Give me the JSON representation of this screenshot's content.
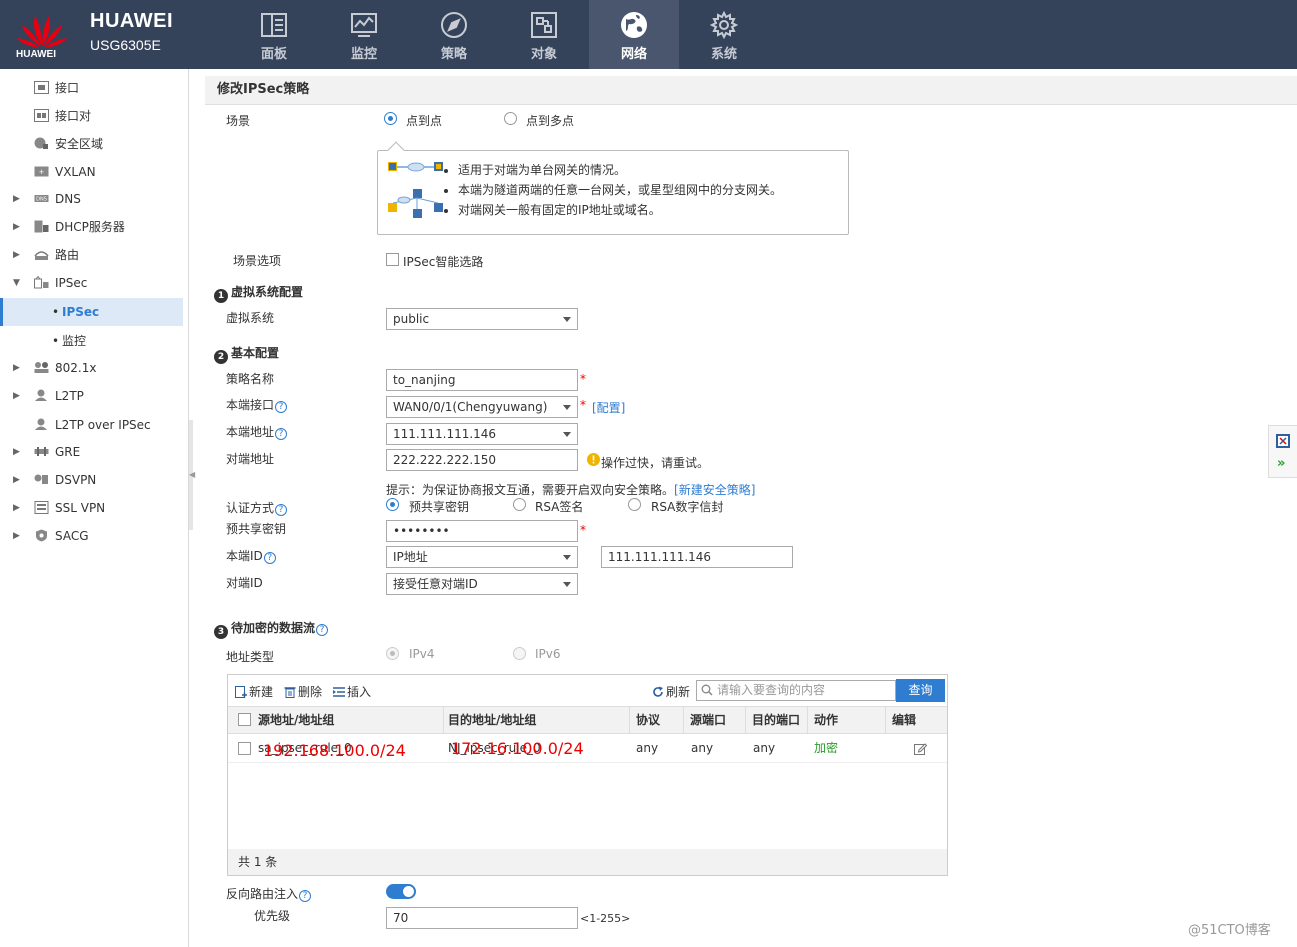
{
  "header": {
    "brand": "HUAWEI",
    "logo_text": "HUAWEI",
    "model": "USG6305E",
    "nav": [
      {
        "label": "面板",
        "icon": "dashboard-icon"
      },
      {
        "label": "监控",
        "icon": "monitor-icon"
      },
      {
        "label": "策略",
        "icon": "compass-icon"
      },
      {
        "label": "对象",
        "icon": "object-icon"
      },
      {
        "label": "网络",
        "icon": "network-icon",
        "active": true
      },
      {
        "label": "系统",
        "icon": "gear-icon"
      }
    ]
  },
  "sidebar": {
    "items": [
      {
        "label": "接口",
        "icon": "interface-icon"
      },
      {
        "label": "接口对",
        "icon": "interface-pair-icon"
      },
      {
        "label": "安全区域",
        "icon": "security-zone-icon"
      },
      {
        "label": "VXLAN",
        "icon": "vxlan-icon"
      },
      {
        "label": "DNS",
        "icon": "dns-icon",
        "expander": "right"
      },
      {
        "label": "DHCP服务器",
        "icon": "dhcp-icon",
        "expander": "right"
      },
      {
        "label": "路由",
        "icon": "route-icon",
        "expander": "right"
      },
      {
        "label": "IPSec",
        "icon": "ipsec-icon",
        "expander": "down"
      },
      {
        "label": "IPSec",
        "sub": true,
        "active": true
      },
      {
        "label": "监控",
        "sub": true
      },
      {
        "label": "802.1x",
        "icon": "dot1x-icon",
        "expander": "right"
      },
      {
        "label": "L2TP",
        "icon": "l2tp-icon",
        "expander": "right"
      },
      {
        "label": "L2TP over IPSec",
        "icon": "l2tp-ipsec-icon"
      },
      {
        "label": "GRE",
        "icon": "gre-icon",
        "expander": "right"
      },
      {
        "label": "DSVPN",
        "icon": "dsvpn-icon",
        "expander": "right"
      },
      {
        "label": "SSL VPN",
        "icon": "sslvpn-icon",
        "expander": "right"
      },
      {
        "label": "SACG",
        "icon": "sacg-icon",
        "expander": "right"
      }
    ]
  },
  "form": {
    "title": "修改IPSec策略",
    "scene_label": "场景",
    "scene_options": [
      "点到点",
      "点到多点"
    ],
    "scene_info": [
      "适用于对端为单台网关的情况。",
      "本端为隧道两端的任意一台网关，或星型组网中的分支网关。",
      "对端网关一般有固定的IP地址或域名。"
    ],
    "scene_option_label": "场景选项",
    "smart_routing_label": "IPSec智能选路",
    "section1": {
      "num": "1",
      "title": "虚拟系统配置"
    },
    "vsys_label": "虚拟系统",
    "vsys_value": "public",
    "section2": {
      "num": "2",
      "title": "基本配置"
    },
    "policy_name_label": "策略名称",
    "policy_name_value": "to_nanjing",
    "local_if_label": "本端接口",
    "local_if_value": "WAN0/0/1(Chengyuwang)",
    "config_link": "[配置]",
    "local_addr_label": "本端地址",
    "local_addr_value": "111.111.111.146",
    "peer_addr_label": "对端地址",
    "peer_addr_value": "222.222.222.150",
    "peer_warning": "操作过快，请重试。",
    "hint_text": "提示：为保证协商报文互通，需要开启双向安全策略。",
    "hint_link": "[新建安全策略]",
    "auth_label": "认证方式",
    "auth_options": [
      "预共享密钥",
      "RSA签名",
      "RSA数字信封"
    ],
    "psk_label": "预共享密钥",
    "psk_value": "••••••••",
    "required_mark": "*",
    "local_id_label": "本端ID",
    "local_id_type": "IP地址",
    "local_id_value": "111.111.111.146",
    "peer_id_label": "对端ID",
    "peer_id_value": "接受任意对端ID",
    "section3": {
      "num": "3",
      "title": "待加密的数据流"
    },
    "addr_type_label": "地址类型",
    "addr_type_options": [
      "IPv4",
      "IPv6"
    ],
    "toolbar": {
      "new": "新建",
      "delete": "删除",
      "insert": "插入",
      "refresh": "刷新",
      "search_placeholder": "请输入要查询的内容",
      "query": "查询"
    },
    "table": {
      "columns": [
        "源地址/地址组",
        "目的地址/地址组",
        "协议",
        "源端口",
        "目的端口",
        "动作",
        "编辑"
      ],
      "rows": [
        {
          "src": "sa_ipsec_rule_0",
          "dst": "NJ_ipsec_rule_0",
          "protocol": "any",
          "src_port": "any",
          "dst_port": "any",
          "action": "加密"
        }
      ],
      "footer": "共 1 条"
    },
    "annotations": {
      "src": "192.168.100.0/24",
      "dst": "172.16.100.0/24"
    },
    "reverse_route_label": "反向路由注入",
    "priority_label": "优先级",
    "priority_value": "70",
    "priority_range": "<1-255>"
  },
  "watermark": "@51CTO博客",
  "colors": {
    "header_bg": "#34425a",
    "accent": "#2f7dd1",
    "warning": "#f0b400",
    "encrypt": "#2a9d2a",
    "annotation": "#e00000"
  }
}
